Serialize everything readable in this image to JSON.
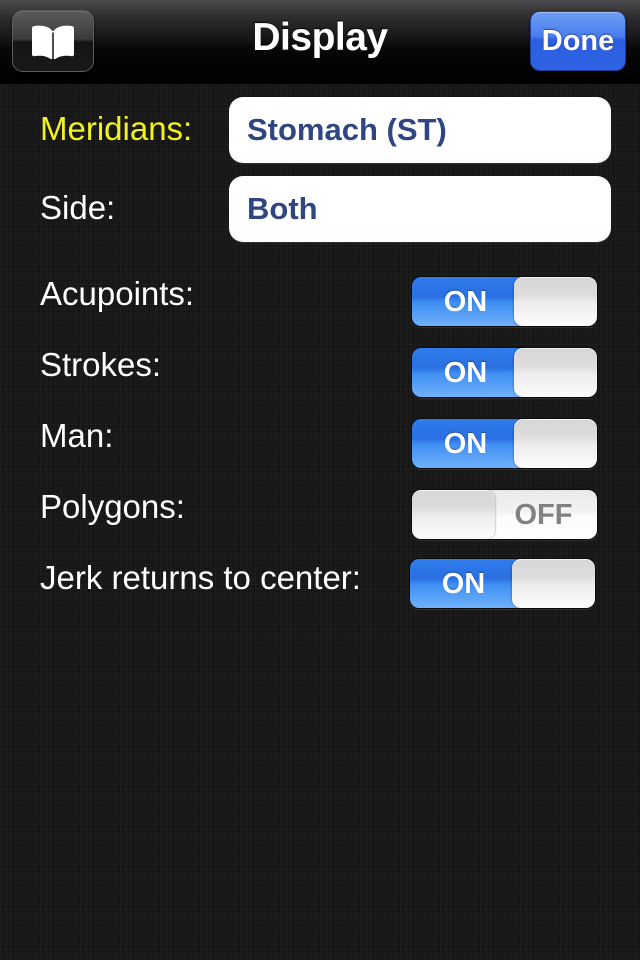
{
  "navbar": {
    "book_button_icon": "open-book-icon",
    "title": "Display",
    "done_label": "Done"
  },
  "colors": {
    "accent_yellow": "#f2f21c",
    "field_text_blue": "#2f4682",
    "switch_on_blue": "#2f7ced",
    "done_blue": "#2f63e4",
    "background": "#161616"
  },
  "form": {
    "selects": [
      {
        "label": "Meridians:",
        "value": "Stomach (ST)",
        "label_accent": true
      },
      {
        "label": "Side:",
        "value": "Both",
        "label_accent": false
      }
    ],
    "switches": [
      {
        "label": "Acupoints:",
        "state": "ON"
      },
      {
        "label": "Strokes:",
        "state": "ON"
      },
      {
        "label": "Man:",
        "state": "ON"
      },
      {
        "label": "Polygons:",
        "state": "OFF"
      },
      {
        "label": "Jerk returns to center:",
        "state": "ON"
      }
    ]
  }
}
